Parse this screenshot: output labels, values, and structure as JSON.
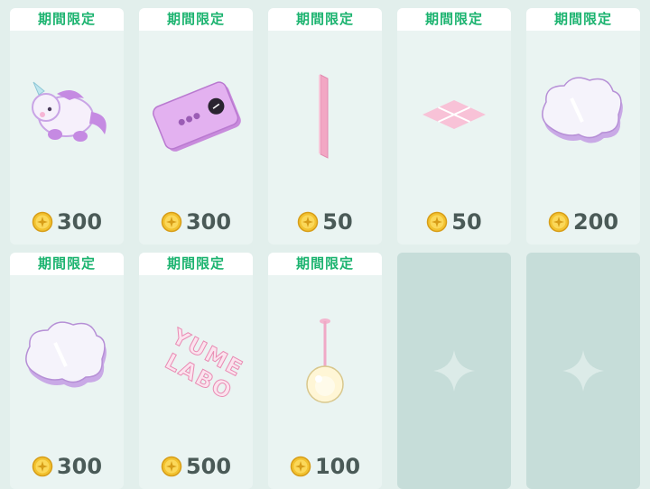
{
  "banner_label": "期間限定",
  "items": [
    {
      "price": "300",
      "item_icon": "unicorn-plush-icon"
    },
    {
      "price": "300",
      "item_icon": "purple-device-icon"
    },
    {
      "price": "50",
      "item_icon": "pink-panel-icon"
    },
    {
      "price": "50",
      "item_icon": "pink-floor-tile-icon"
    },
    {
      "price": "200",
      "item_icon": "cloud-icon"
    },
    {
      "price": "300",
      "item_icon": "cloud-icon"
    },
    {
      "price": "500",
      "item_icon": "yume-labo-neon-sign-icon"
    },
    {
      "price": "100",
      "item_icon": "pendant-light-icon"
    }
  ],
  "neon_sign_text": "YUME LABO",
  "empty_slot_icon": "sparkle-icon",
  "colors": {
    "banner_text": "#1bb36f",
    "card_background": "#eaf4f2",
    "empty_card_background": "#c6ddd9",
    "price_text": "#4a5a57",
    "coin": "#f2c230"
  }
}
